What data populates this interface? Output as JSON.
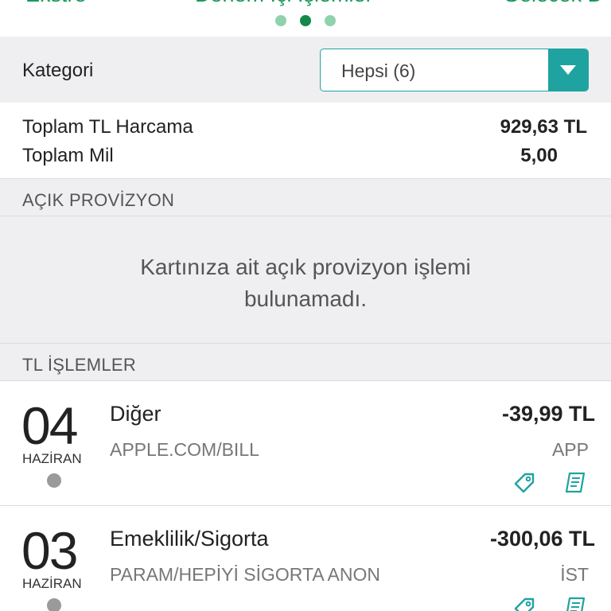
{
  "pager": {
    "tabs": [
      "Ekstre",
      "Dönem İçi İşlemler",
      "Gelecek D"
    ],
    "active_index": 1,
    "page_count": 3
  },
  "category": {
    "label": "Kategori",
    "selected": "Hepsi (6)"
  },
  "totals": {
    "tl_label": "Toplam TL Harcama",
    "tl_value": "929,63 TL",
    "mil_label": "Toplam Mil",
    "mil_value": "5,00"
  },
  "provision": {
    "title": "AÇIK PROVİZYON",
    "empty_message": "Kartınıza ait açık provizyon işlemi bulunamadı."
  },
  "transactions_section": {
    "title": "TL İŞLEMLER"
  },
  "transactions": [
    {
      "day": "04",
      "month": "HAZİRAN",
      "category": "Diğer",
      "merchant": "APPLE.COM/BILL",
      "amount": "-39,99 TL",
      "place": "APP"
    },
    {
      "day": "03",
      "month": "HAZİRAN",
      "category": "Emeklilik/Sigorta",
      "merchant": "PARAM/HEPİYİ SİGORTA ANON",
      "amount": "-300,06 TL",
      "place": "İST"
    }
  ],
  "colors": {
    "accent": "#1fa3a0",
    "pager_green": "#1a9a5a",
    "dot_active": "#13884a",
    "dot_inactive": "#8fd2ac"
  },
  "icons": {
    "dropdown": "chevron-down-icon",
    "tag": "tag-icon",
    "receipt": "receipt-icon"
  }
}
